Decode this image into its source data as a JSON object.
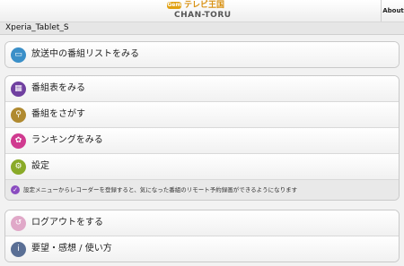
{
  "header": {
    "logo_mark": "Gem",
    "logo_jp": "テレビ王国",
    "logo_en": "CHAN-TORU",
    "about_label": "About"
  },
  "device": {
    "name": "Xperia_Tablet_S"
  },
  "menu1": {
    "items": [
      {
        "label": "放送中の番組リストをみる",
        "icon": "tv-icon",
        "glyph": "▭"
      }
    ]
  },
  "menu2": {
    "items": [
      {
        "label": "番組表をみる",
        "icon": "grid-icon",
        "glyph": "▦"
      },
      {
        "label": "番組をさがす",
        "icon": "search-icon",
        "glyph": "⚲"
      },
      {
        "label": "ランキングをみる",
        "icon": "medal-icon",
        "glyph": "✿"
      },
      {
        "label": "設定",
        "icon": "gear-icon",
        "glyph": "⚙"
      }
    ],
    "note": "設定メニューからレコーダーを登録すると、気になった番組のリモート予約録画ができるようになります"
  },
  "menu3": {
    "items": [
      {
        "label": "ログアウトをする",
        "icon": "logout-icon",
        "glyph": "↺"
      },
      {
        "label": "要望・感想 / 使い方",
        "icon": "info-icon",
        "glyph": "i"
      }
    ]
  }
}
